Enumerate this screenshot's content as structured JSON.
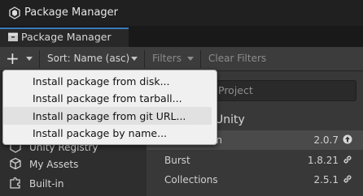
{
  "window": {
    "title": "Package Manager"
  },
  "tab": {
    "label": "Package Manager"
  },
  "toolbar": {
    "sort_label": "Sort: Name (asc)",
    "filters_label": "Filters",
    "clear_filters_label": "Clear Filters"
  },
  "search": {
    "placeholder": "Project"
  },
  "list": {
    "group_title": "Unity",
    "rows": [
      {
        "name": "on",
        "version": "2.0.7",
        "icon": "update-arrow-icon"
      },
      {
        "name": "Burst",
        "version": "1.8.21",
        "icon": "link-icon"
      },
      {
        "name": "Collections",
        "version": "2.5.1",
        "icon": "link-icon"
      }
    ]
  },
  "sidebar": {
    "items": [
      {
        "label": "Unity Registry",
        "icon": "unity-registry-icon"
      },
      {
        "label": "My Assets",
        "icon": "cube-icon"
      },
      {
        "label": "Built-in",
        "icon": "puzzle-icon"
      }
    ]
  },
  "add_menu": {
    "items": [
      {
        "label": "Install package from disk..."
      },
      {
        "label": "Install package from tarball..."
      },
      {
        "label": "Install package from git URL..."
      },
      {
        "label": "Install package by name..."
      }
    ],
    "highlighted_index": 2
  },
  "colors": {
    "accent": "#3a79bb",
    "window_bg": "#383838",
    "menu_bg": "#f0f0f0",
    "menu_highlight": "#e1e1e1"
  }
}
